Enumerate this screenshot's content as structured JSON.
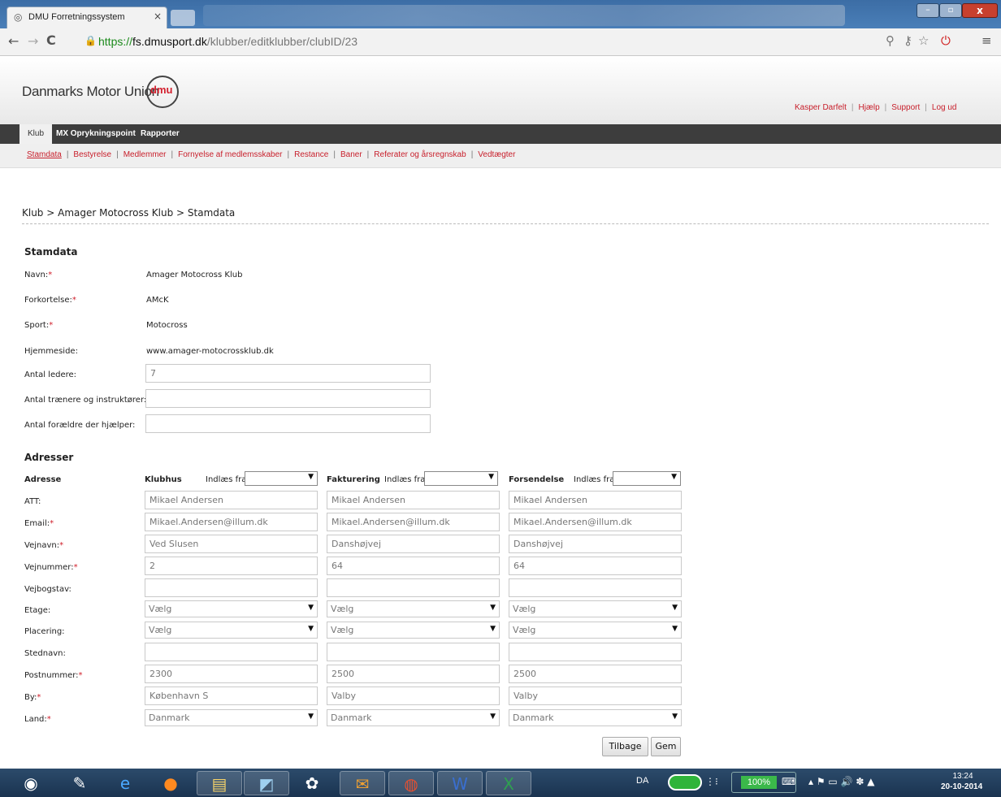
{
  "browser": {
    "tab_title": "DMU Forretningssystem",
    "tab_close": "×",
    "url_scheme": "https://",
    "url_domain": "fs.dmusport.dk",
    "url_path": "/klubber/editklubber/clubID/23",
    "window_controls": {
      "minimize": "–",
      "maximize": "▫",
      "close": "x"
    }
  },
  "header": {
    "logo_text": "Danmarks Motor Union",
    "logo_mark": "dmu",
    "user_links": [
      "Kasper Darfelt",
      "Hjælp",
      "Support",
      "Log ud"
    ]
  },
  "main_nav": [
    "Klub",
    "MX Oprykningspoint",
    "Rapporter"
  ],
  "sub_nav": [
    "Stamdata",
    "Bestyrelse",
    "Medlemmer",
    "Fornyelse af medlemsskaber",
    "Restance",
    "Baner",
    "Referater og årsregnskab",
    "Vedtægter"
  ],
  "breadcrumb": "Klub > Amager Motocross Klub > Stamdata",
  "stamdata": {
    "heading": "Stamdata",
    "navn_label": "Navn:",
    "navn_value": "Amager Motocross Klub",
    "forkortelse_label": "Forkortelse:",
    "forkortelse_value": "AMcK",
    "sport_label": "Sport:",
    "sport_value": "Motocross",
    "hjemmeside_label": "Hjemmeside:",
    "hjemmeside_value": "www.amager-motocrossklub.dk",
    "ledere_label": "Antal ledere:",
    "ledere_value": "7",
    "traenere_label": "Antal trænere og instruktører:",
    "traenere_value": "",
    "foraeldre_label": "Antal forældre der hjælper:",
    "foraeldre_value": ""
  },
  "adresser": {
    "heading": "Adresser",
    "col_label": "Adresse",
    "indlaes": "Indlæs fra",
    "columns": [
      {
        "name": "Klubhus",
        "att": "Mikael Andersen",
        "email": "Mikael.Andersen@illum.dk",
        "vejnavn": "Ved Slusen",
        "vejnummer": "2",
        "vejbogstav": "",
        "etage": "Vælg",
        "placering": "Vælg",
        "stednavn": "",
        "postnummer": "2300",
        "by": "København S",
        "land": "Danmark"
      },
      {
        "name": "Fakturering",
        "att": "Mikael Andersen",
        "email": "Mikael.Andersen@illum.dk",
        "vejnavn": "Danshøjvej",
        "vejnummer": "64",
        "vejbogstav": "",
        "etage": "Vælg",
        "placering": "Vælg",
        "stednavn": "",
        "postnummer": "2500",
        "by": "Valby",
        "land": "Danmark"
      },
      {
        "name": "Forsendelse",
        "att": "Mikael Andersen",
        "email": "Mikael.Andersen@illum.dk",
        "vejnavn": "Danshøjvej",
        "vejnummer": "64",
        "vejbogstav": "",
        "etage": "Vælg",
        "placering": "Vælg",
        "stednavn": "",
        "postnummer": "2500",
        "by": "Valby",
        "land": "Danmark"
      }
    ],
    "labels": {
      "att": "ATT:",
      "email": "Email:",
      "vejnavn": "Vejnavn:",
      "vejnummer": "Vejnummer:",
      "vejbogstav": "Vejbogstav:",
      "etage": "Etage:",
      "placering": "Placering:",
      "stednavn": "Stednavn:",
      "postnummer": "Postnummer:",
      "by": "By:",
      "land": "Land:"
    }
  },
  "buttons": {
    "back": "Tilbage",
    "save": "Gem"
  },
  "required_mark": "*",
  "taskbar": {
    "language": "DA",
    "zoom": "100%",
    "time": "13:24",
    "date": "20-10-2014"
  }
}
